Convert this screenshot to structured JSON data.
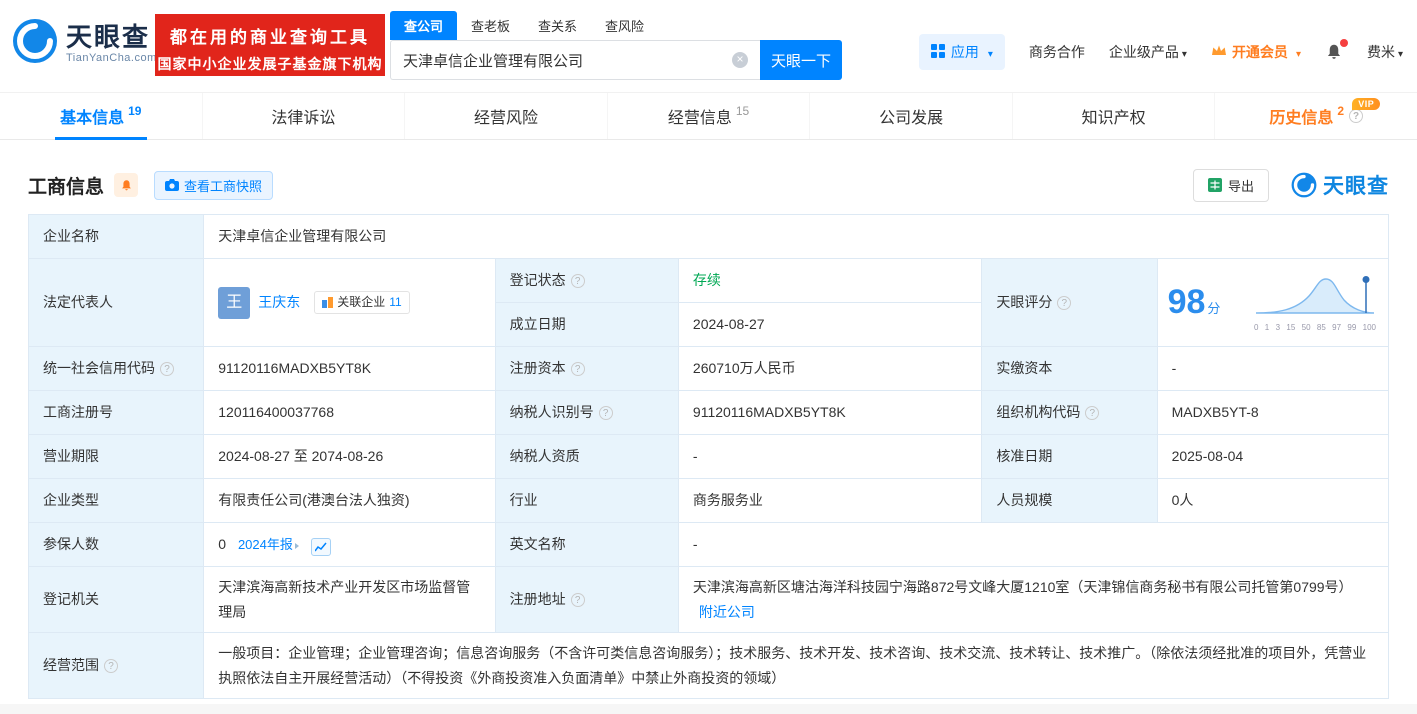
{
  "colors": {
    "accent_blue": "#0084ff",
    "brand_red": "#e1251b",
    "vip_orange": "#ff7d20",
    "status_green": "#00a854",
    "label_cell_bg": "#e8f4fc",
    "table_border": "#dde9f4",
    "score_blue": "#2b8ded"
  },
  "header": {
    "logo": {
      "brand": "天眼查",
      "domain": "TianYanCha.com"
    },
    "promo": {
      "line1": "都在用的商业查询工具",
      "line2": "国家中小企业发展子基金旗下机构"
    },
    "search_tabs": [
      {
        "label": "查公司"
      },
      {
        "label": "查老板"
      },
      {
        "label": "查关系"
      },
      {
        "label": "查风险"
      }
    ],
    "search": {
      "value": "天津卓信企业管理有限公司",
      "button_label": "天眼一下"
    },
    "nav": {
      "apps": "应用",
      "business_cooperation": "商务合作",
      "enterprise_products": "企业级产品",
      "vip": "开通会员",
      "username": "费米"
    }
  },
  "tabs": [
    {
      "label": "基本信息",
      "count": "19"
    },
    {
      "label": "法律诉讼",
      "count": ""
    },
    {
      "label": "经营风险",
      "count": ""
    },
    {
      "label": "经营信息",
      "count": "15"
    },
    {
      "label": "公司发展",
      "count": ""
    },
    {
      "label": "知识产权",
      "count": ""
    },
    {
      "label": "历史信息",
      "count": "2",
      "badge": "VIP"
    }
  ],
  "section": {
    "title": "工商信息",
    "snapshot_button": "查看工商快照",
    "export_button": "导出",
    "brand_watermark": "天眼查"
  },
  "score": {
    "value": "98",
    "unit": "分",
    "axis": [
      "0",
      "1",
      "3",
      "15",
      "50",
      "85",
      "97",
      "99",
      "100"
    ]
  },
  "fields": {
    "company_name": {
      "label": "企业名称",
      "value": "天津卓信企业管理有限公司"
    },
    "legal_rep": {
      "label": "法定代表人",
      "avatar": "王",
      "name": "王庆东",
      "related_label": "关联企业",
      "related_count": "11"
    },
    "reg_status": {
      "label": "登记状态",
      "value": "存续"
    },
    "tianyan_score": {
      "label": "天眼评分"
    },
    "est_date": {
      "label": "成立日期",
      "value": "2024-08-27"
    },
    "credit_code": {
      "label": "统一社会信用代码",
      "value": "91120116MADXB5YT8K"
    },
    "reg_capital": {
      "label": "注册资本",
      "value": "260710万人民币"
    },
    "paid_capital": {
      "label": "实缴资本",
      "value": "-"
    },
    "reg_number": {
      "label": "工商注册号",
      "value": "120116400037768"
    },
    "taxpayer_id": {
      "label": "纳税人识别号",
      "value": "91120116MADXB5YT8K"
    },
    "org_code": {
      "label": "组织机构代码",
      "value": "MADXB5YT-8"
    },
    "business_term": {
      "label": "营业期限",
      "value": "2024-08-27 至 2074-08-26"
    },
    "taxpayer_qualification": {
      "label": "纳税人资质",
      "value": "-"
    },
    "approval_date": {
      "label": "核准日期",
      "value": "2025-08-04"
    },
    "company_type": {
      "label": "企业类型",
      "value": "有限责任公司(港澳台法人独资)"
    },
    "industry": {
      "label": "行业",
      "value": "商务服务业"
    },
    "staff_size": {
      "label": "人员规模",
      "value": "0人"
    },
    "insured_count": {
      "label": "参保人数",
      "value": "0",
      "report_link": "2024年报"
    },
    "english_name": {
      "label": "英文名称",
      "value": "-"
    },
    "reg_authority": {
      "label": "登记机关",
      "value": "天津滨海高新技术产业开发区市场监督管理局"
    },
    "reg_address": {
      "label": "注册地址",
      "value": "天津滨海高新区塘沽海洋科技园宁海路872号文峰大厦1210室（天津锦信商务秘书有限公司托管第0799号）",
      "nearby_link": "附近公司"
    },
    "business_scope": {
      "label": "经营范围",
      "value": "一般项目：企业管理；企业管理咨询；信息咨询服务（不含许可类信息咨询服务）；技术服务、技术开发、技术咨询、技术交流、技术转让、技术推广。（除依法须经批准的项目外，凭营业执照依法自主开展经营活动）（不得投资《外商投资准入负面清单》中禁止外商投资的领域）"
    }
  }
}
